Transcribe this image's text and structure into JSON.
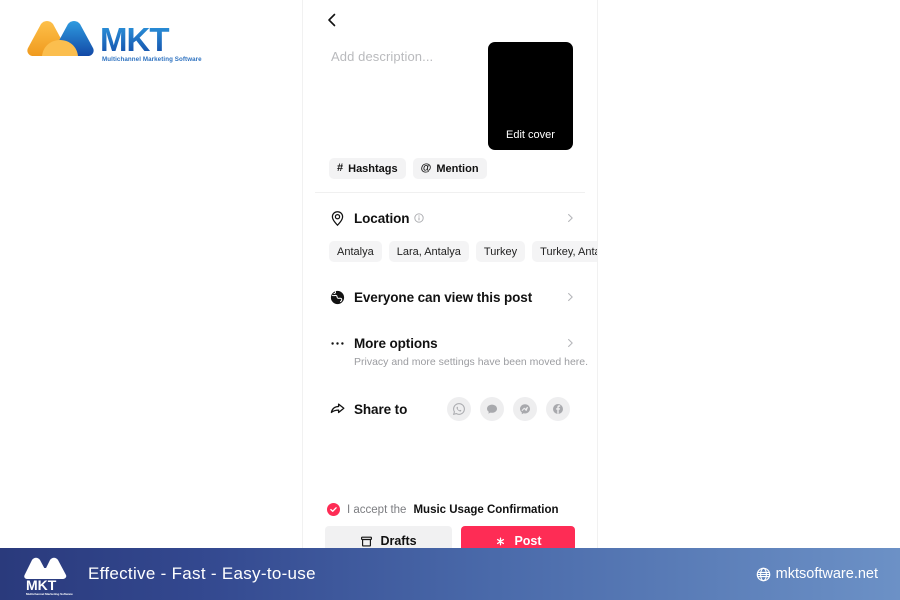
{
  "brand": {
    "logo_text": "MKT",
    "logo_tagline": "Multichannel Marketing Software"
  },
  "panel": {
    "back_icon": "chevron-left-icon",
    "description": {
      "value": "",
      "placeholder": "Add description..."
    },
    "cover": {
      "label": "Edit cover"
    },
    "chips": [
      {
        "glyph": "#",
        "label": "Hashtags",
        "icon": "hashtag-icon"
      },
      {
        "glyph": "@",
        "label": "Mention",
        "icon": "at-icon"
      }
    ],
    "location": {
      "label": "Location",
      "icon": "location-pin-icon",
      "info_icon": "info-icon",
      "chevron": "chevron-right-icon",
      "suggestions": [
        "Antalya",
        "Lara, Antalya",
        "Turkey",
        "Turkey, Antalya, B"
      ]
    },
    "privacy": {
      "label": "Everyone can view this post",
      "icon": "globe-icon",
      "chevron": "chevron-right-icon"
    },
    "more_options": {
      "label": "More options",
      "sub": "Privacy and more settings have been moved here.",
      "icon": "ellipsis-icon",
      "chevron": "chevron-right-icon"
    },
    "share": {
      "label": "Share to",
      "icon": "share-arrow-icon",
      "targets": [
        {
          "name": "whatsapp-icon",
          "label": "WhatsApp"
        },
        {
          "name": "message-bubble-icon",
          "label": "Messages"
        },
        {
          "name": "messenger-icon",
          "label": "Messenger"
        },
        {
          "name": "facebook-icon",
          "label": "Facebook"
        }
      ]
    },
    "accept": {
      "prefix": "I accept the ",
      "link": "Music Usage Confirmation",
      "checked": true,
      "check_icon": "check-circle-icon"
    },
    "buttons": {
      "drafts": "Drafts",
      "drafts_icon": "archive-box-icon",
      "post": "Post",
      "post_icon": "sparkle-icon"
    }
  },
  "banner": {
    "logo_text": "MKT",
    "logo_tagline": "Multichannel Marketing Software",
    "tagline": "Effective - Fast - Easy-to-use",
    "site": "mktsoftware.net",
    "site_icon": "globe-icon"
  },
  "colors": {
    "accent_red": "#FE2C55",
    "chip_bg": "#F3F3F4",
    "banner_dark": "#2A3A7C",
    "banner_light": "#6C91C6",
    "logo_orange": "#F5A623",
    "logo_blue": "#1B6FD0"
  }
}
